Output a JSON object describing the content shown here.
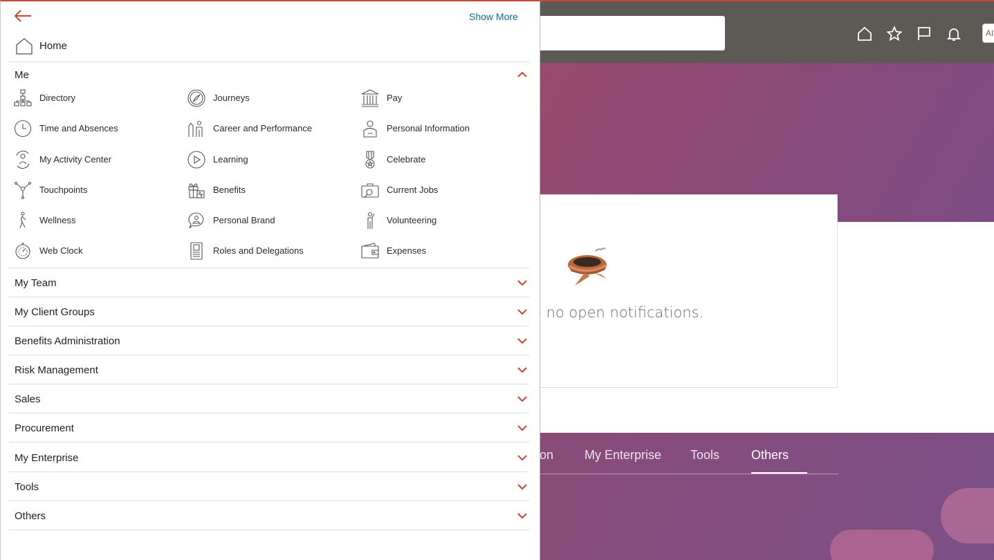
{
  "header": {
    "avatar_text": "AI"
  },
  "background": {
    "notification_text": "e no open notifications.",
    "tabs": [
      {
        "label": "on"
      },
      {
        "label": "My Enterprise"
      },
      {
        "label": "Tools"
      },
      {
        "label": "Others"
      }
    ]
  },
  "drawer": {
    "show_more": "Show More",
    "home_label": "Home",
    "me": {
      "label": "Me",
      "expanded": true,
      "items": [
        {
          "label": "Directory",
          "icon": "directory-icon"
        },
        {
          "label": "Journeys",
          "icon": "compass-icon"
        },
        {
          "label": "Pay",
          "icon": "bank-icon"
        },
        {
          "label": "Time and Absences",
          "icon": "clock-icon"
        },
        {
          "label": "Career and Performance",
          "icon": "career-icon"
        },
        {
          "label": "Personal Information",
          "icon": "person-badge-icon"
        },
        {
          "label": "My Activity Center",
          "icon": "activity-icon"
        },
        {
          "label": "Learning",
          "icon": "play-icon"
        },
        {
          "label": "Celebrate",
          "icon": "medal-icon"
        },
        {
          "label": "Touchpoints",
          "icon": "touchpoints-icon"
        },
        {
          "label": "Benefits",
          "icon": "gift-icon"
        },
        {
          "label": "Current Jobs",
          "icon": "job-search-icon"
        },
        {
          "label": "Wellness",
          "icon": "wellness-icon"
        },
        {
          "label": "Personal Brand",
          "icon": "speech-person-icon"
        },
        {
          "label": "Volunteering",
          "icon": "volunteer-icon"
        },
        {
          "label": "Web Clock",
          "icon": "stopwatch-icon"
        },
        {
          "label": "Roles and Delegations",
          "icon": "id-card-icon"
        },
        {
          "label": "Expenses",
          "icon": "wallet-icon"
        }
      ]
    },
    "sections": [
      {
        "label": "My Team"
      },
      {
        "label": "My Client Groups"
      },
      {
        "label": "Benefits Administration"
      },
      {
        "label": "Risk Management"
      },
      {
        "label": "Sales"
      },
      {
        "label": "Procurement"
      },
      {
        "label": "My Enterprise"
      },
      {
        "label": "Tools"
      },
      {
        "label": "Others"
      }
    ]
  },
  "colors": {
    "accent": "#c74634",
    "link": "#0e6b8c",
    "topbar": "#5d5955"
  }
}
